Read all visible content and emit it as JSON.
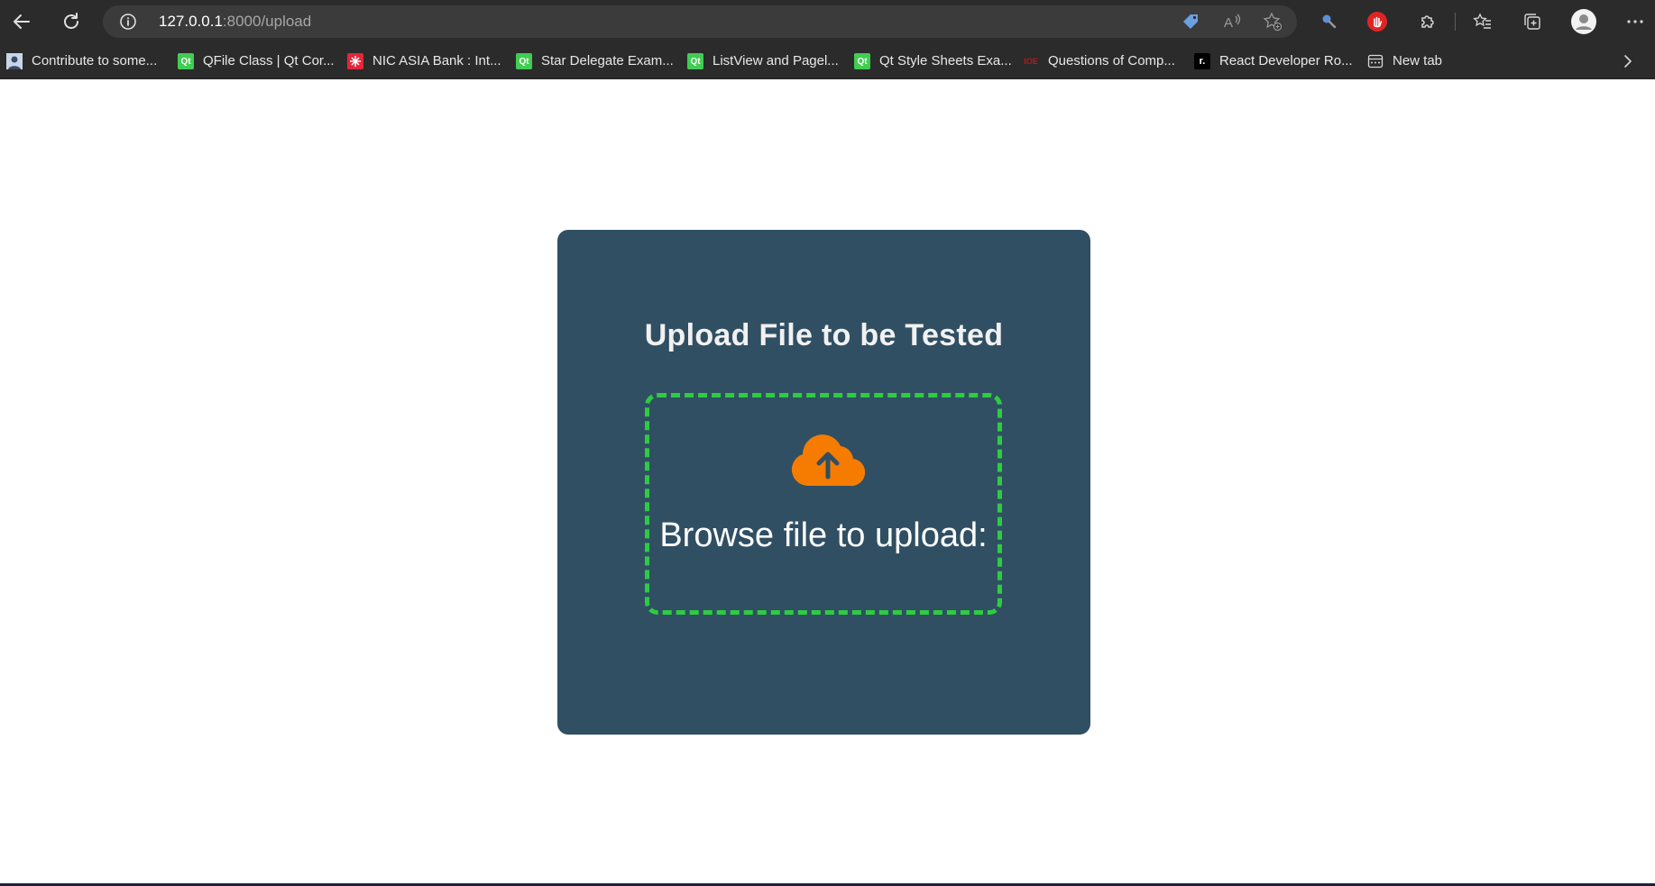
{
  "browser": {
    "url_host": "127.0.0.1",
    "url_rest": ":8000/upload",
    "bookmarks": [
      {
        "label": "Contribute to some...",
        "icon": "user-avatar-icon"
      },
      {
        "label": "QFile Class | Qt Cor...",
        "icon": "qt-icon",
        "icon_text": "Qt"
      },
      {
        "label": "NIC ASIA Bank : Int...",
        "icon": "nic-asia-icon"
      },
      {
        "label": "Star Delegate Exam...",
        "icon": "qt-icon",
        "icon_text": "Qt"
      },
      {
        "label": "ListView and Pagel...",
        "icon": "qt-icon",
        "icon_text": "Qt"
      },
      {
        "label": "Qt Style Sheets Exa...",
        "icon": "qt-icon",
        "icon_text": "Qt"
      },
      {
        "label": "Questions of Comp...",
        "icon": "ioe-icon",
        "icon_text": "IOE"
      },
      {
        "label": "React Developer Ro...",
        "icon": "roadmap-icon",
        "icon_text": "r."
      },
      {
        "label": "New tab",
        "icon": "new-tab-icon"
      }
    ]
  },
  "page": {
    "title": "Upload File to be Tested",
    "dropzone_label": "Browse file to upload:"
  },
  "colors": {
    "card_bg": "#304f63",
    "dropzone_border": "#2ecc40",
    "cloud_icon": "#f57c00"
  }
}
